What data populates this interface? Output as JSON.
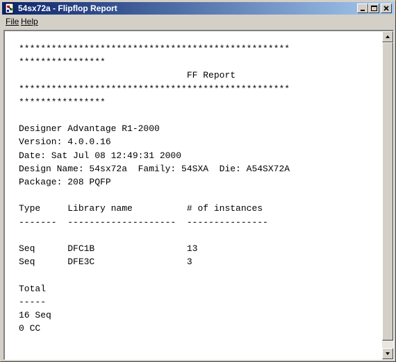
{
  "window": {
    "title": "54sx72a - Flipflop Report",
    "titlebar_gradient_start": "#0a246a",
    "titlebar_gradient_end": "#a6caf0"
  },
  "icons": {
    "app": "report-app-icon",
    "minimize": "minimize-icon",
    "maximize": "maximize-icon",
    "close": "close-icon",
    "scroll_up": "arrow-up-icon",
    "scroll_down": "arrow-down-icon"
  },
  "menu": {
    "file_label": "File",
    "help_label": "Help"
  },
  "report": {
    "lines": [
      "**************************************************",
      "****************",
      "                               FF Report",
      "**************************************************",
      "****************",
      "",
      "Designer Advantage R1-2000",
      "Version: 4.0.0.16",
      "Date: Sat Jul 08 12:49:31 2000",
      "Design Name: 54sx72a  Family: 54SXA  Die: A54SX72A",
      "Package: 208 PQFP",
      "",
      "Type     Library name          # of instances",
      "-------  --------------------  ---------------",
      "",
      "Seq      DFC1B                 13",
      "Seq      DFE3C                 3",
      "",
      "Total",
      "-----",
      "16 Seq",
      "0 CC"
    ]
  }
}
